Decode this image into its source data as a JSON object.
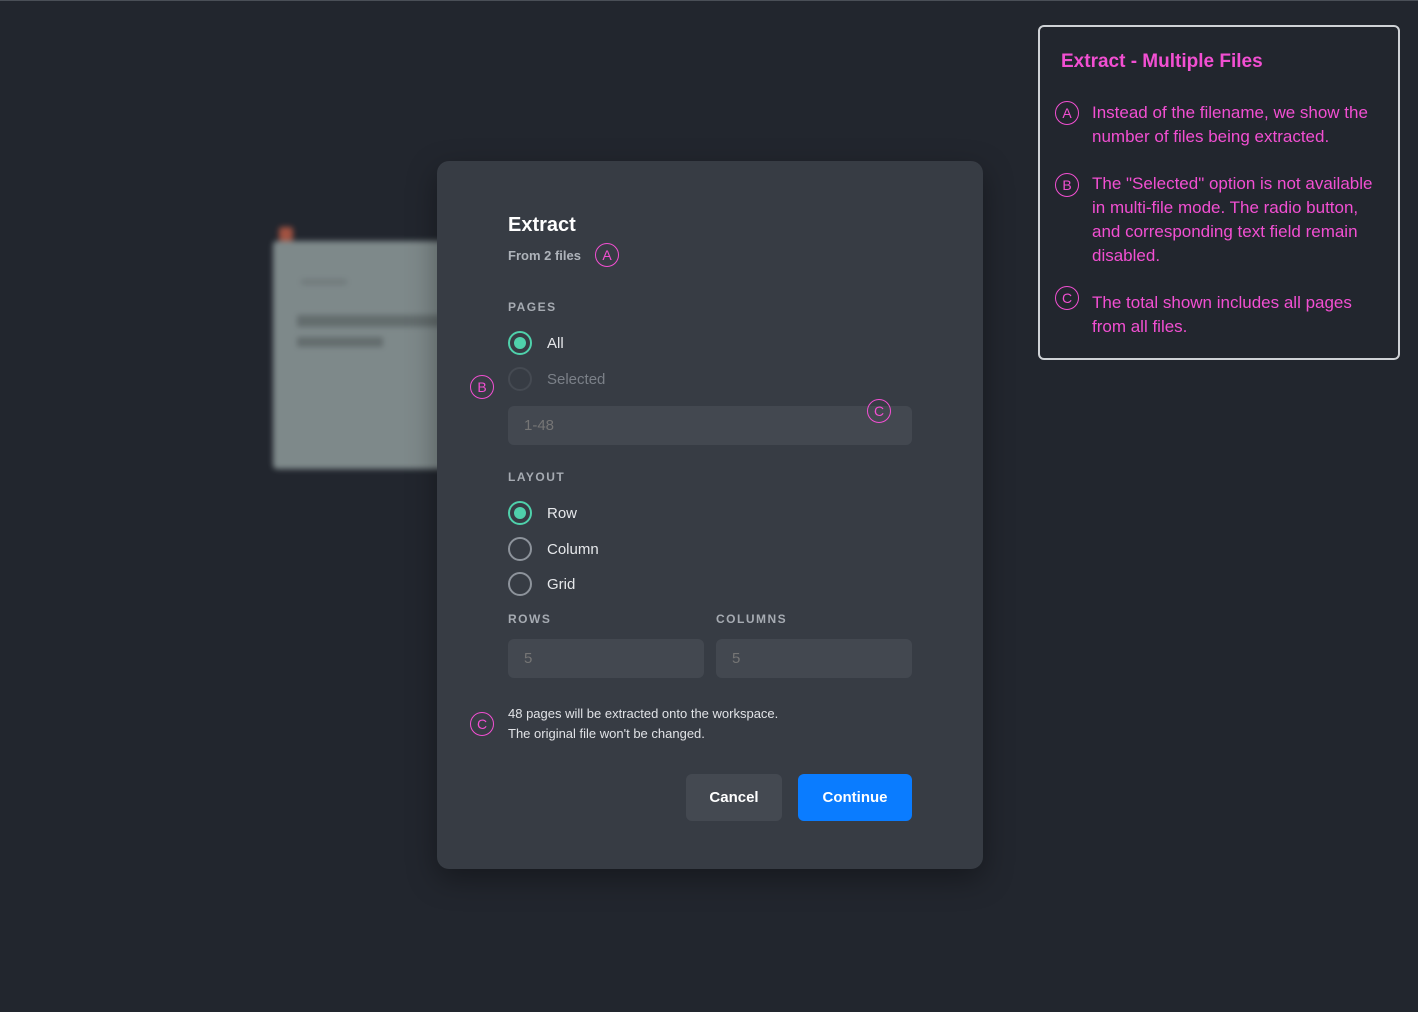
{
  "dialog": {
    "title": "Extract",
    "subtitle": "From 2 files",
    "pages_label": "PAGES",
    "pages_options": [
      "All",
      "Selected"
    ],
    "pages_range_placeholder": "1-48",
    "layout_label": "LAYOUT",
    "layout_options": [
      "Row",
      "Column",
      "Grid"
    ],
    "rows_label": "ROWS",
    "columns_label": "COLUMNS",
    "rows_value": "5",
    "columns_value": "5",
    "info_line1": "48 pages will be extracted onto the workspace.",
    "info_line2": "The original file won't be changed.",
    "cancel_label": "Cancel",
    "continue_label": "Continue"
  },
  "markers": {
    "a": "A",
    "b": "B",
    "c": "C"
  },
  "note": {
    "title": "Extract - Multiple Files",
    "items": [
      "Instead of the filename, we show the number of files being extracted.",
      "The \"Selected\" option is not available in multi-file mode.  The radio button, and corresponding text field remain disabled.",
      "The total shown includes all pages from all files."
    ]
  },
  "colors": {
    "accent": "#4fd1ab",
    "primary": "#0a7cff",
    "annotation": "#f24fd2",
    "modal": "#373c44",
    "background": "#22262e"
  }
}
